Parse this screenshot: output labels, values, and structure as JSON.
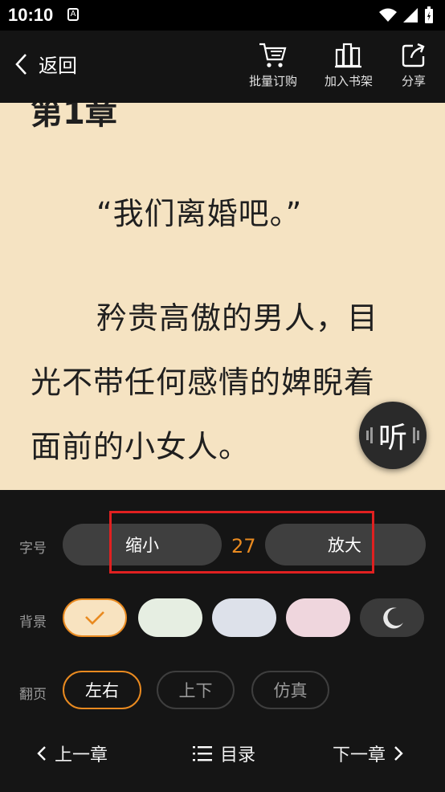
{
  "status_bar": {
    "time": "10:10",
    "notification_letter": "A"
  },
  "topbar": {
    "back_label": "返回",
    "actions": [
      {
        "label": "批量订购",
        "icon": "cart-icon"
      },
      {
        "label": "加入书架",
        "icon": "bookshelf-icon"
      },
      {
        "label": "分享",
        "icon": "share-icon"
      }
    ]
  },
  "reader": {
    "chapter_title": "第1章",
    "paragraphs": [
      "“我们离婚吧。”",
      "矜贵高傲的男人，目",
      "光不带任何感情的婢睨着",
      "面前的小女人。"
    ],
    "listen_label": "听",
    "background_color": "#f5e3c2"
  },
  "settings": {
    "font_label": "字号",
    "shrink_label": "缩小",
    "enlarge_label": "放大",
    "font_size": "27",
    "accent_color": "#e98a20",
    "bg_label": "背景",
    "backgrounds": [
      "#f8e3c0",
      "#e6eee2",
      "#dde1ea",
      "#efd6dd",
      "#3a3a3a"
    ],
    "selected_background": 0,
    "page_label": "翻页",
    "page_modes": [
      "左右",
      "上下",
      "仿真"
    ],
    "selected_page_mode": 0
  },
  "nav": {
    "prev": "上一章",
    "toc": "目录",
    "next": "下一章"
  }
}
